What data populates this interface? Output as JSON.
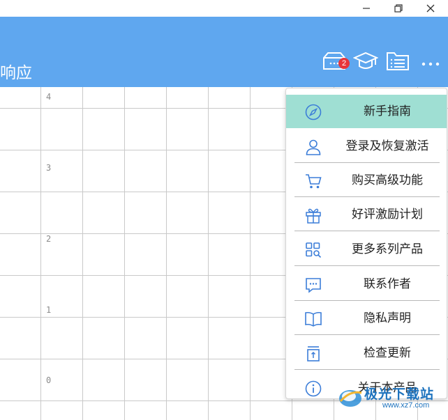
{
  "window": {
    "controls": [
      "minimize-icon",
      "restore-icon",
      "close-icon"
    ]
  },
  "header": {
    "title": "响应",
    "background": "#5fa7ef",
    "notification_count": "2",
    "icons": [
      "inbox-icon",
      "graduation-cap-icon",
      "folder-list-icon",
      "more-icon"
    ]
  },
  "grid": {
    "y_labels": [
      "4",
      "3",
      "2",
      "1",
      "0"
    ]
  },
  "menu": {
    "items": [
      {
        "label": "新手指南",
        "icon": "compass-icon",
        "active": true
      },
      {
        "label": "登录及恢复激活",
        "icon": "user-icon",
        "active": false
      },
      {
        "label": "购买高级功能",
        "icon": "cart-icon",
        "active": false
      },
      {
        "label": "好评激励计划",
        "icon": "gift-icon",
        "active": false
      },
      {
        "label": "更多系列产品",
        "icon": "apps-search-icon",
        "active": false
      },
      {
        "label": "联系作者",
        "icon": "chat-icon",
        "active": false
      },
      {
        "label": "隐私声明",
        "icon": "book-icon",
        "active": false
      },
      {
        "label": "检查更新",
        "icon": "update-icon",
        "active": false
      },
      {
        "label": "关于本产品",
        "icon": "info-icon",
        "active": false
      }
    ],
    "accent": "#3b7dd8",
    "active_background": "#9fdfd3"
  },
  "watermark": {
    "text": "极光下载站",
    "url": "www.xz7.com"
  }
}
